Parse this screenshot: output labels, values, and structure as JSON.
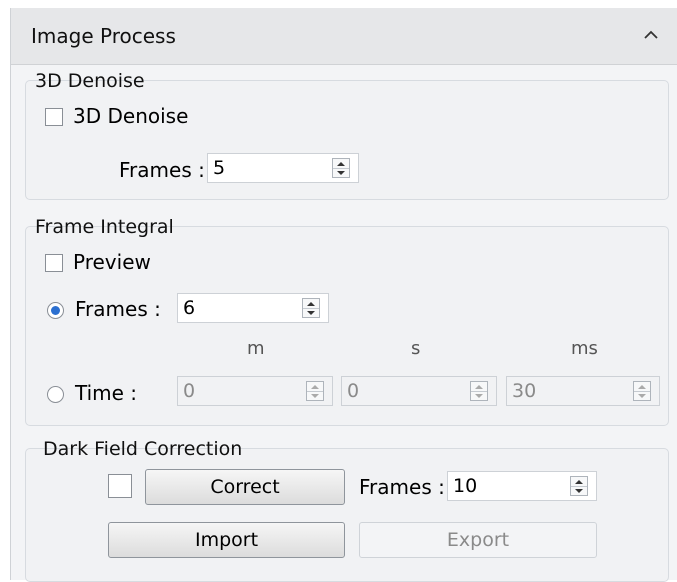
{
  "header": {
    "title": "Image Process"
  },
  "denoise": {
    "legend": "3D Denoise",
    "checkbox_label": "3D Denoise",
    "frames_label": "Frames :",
    "frames_value": "5"
  },
  "integral": {
    "legend": "Frame Integral",
    "preview_label": "Preview",
    "frames_label": "Frames :",
    "frames_value": "6",
    "time_label": "Time :",
    "units": {
      "m": "m",
      "s": "s",
      "ms": "ms"
    },
    "time_values": {
      "m": "0",
      "s": "0",
      "ms": "30"
    }
  },
  "dark_field": {
    "legend": "Dark Field Correction",
    "correct_label": "Correct",
    "frames_label": "Frames :",
    "frames_value": "10",
    "import_label": "Import",
    "export_label": "Export"
  }
}
